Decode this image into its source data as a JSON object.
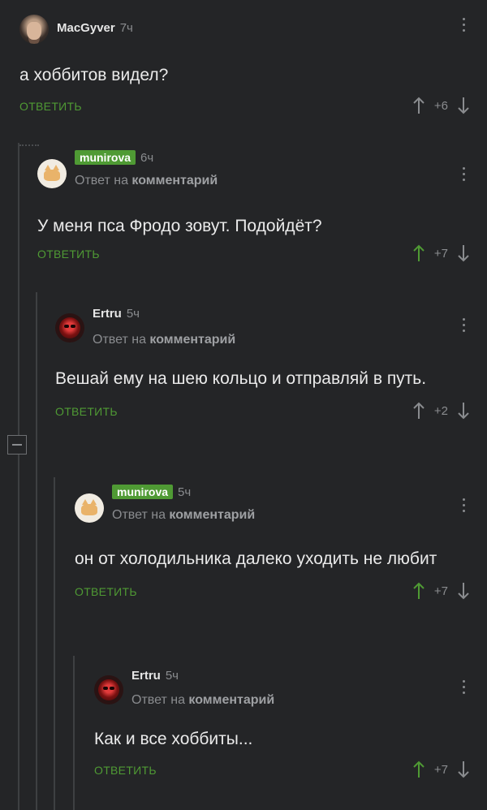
{
  "comments": [
    {
      "username": "MacGyver",
      "time": "7ч",
      "reply_to": "",
      "text": "а хоббитов видел?",
      "reply_label": "ОТВЕТИТЬ",
      "score": "+6",
      "upvoted": false,
      "avatar": "photo-avatar",
      "badge": false
    },
    {
      "username": "munirova",
      "time": "6ч",
      "reply_to_prefix": "Ответ на",
      "reply_to_bold": "комментарий",
      "text": "У меня пса Фродо зовут. Подойдёт?",
      "reply_label": "ОТВЕТИТЬ",
      "score": "+7",
      "upvoted": true,
      "avatar": "cat-avatar",
      "badge": true
    },
    {
      "username": "Ertru",
      "time": "5ч",
      "reply_to_prefix": "Ответ на",
      "reply_to_bold": "комментарий",
      "text": "Вешай ему на шею кольцо и отправляй в путь.",
      "reply_label": "ОТВЕТИТЬ",
      "score": "+2",
      "upvoted": false,
      "avatar": "red-mask-avatar",
      "badge": false
    },
    {
      "username": "munirova",
      "time": "5ч",
      "reply_to_prefix": "Ответ на",
      "reply_to_bold": "комментарий",
      "text": "он от холодильника далеко уходить не любит",
      "reply_label": "ОТВЕТИТЬ",
      "score": "+7",
      "upvoted": true,
      "avatar": "cat-avatar",
      "badge": true
    },
    {
      "username": "Ertru",
      "time": "5ч",
      "reply_to_prefix": "Ответ на",
      "reply_to_bold": "комментарий",
      "text": "Как и все хоббиты...",
      "reply_label": "ОТВЕТИТЬ",
      "score": "+7",
      "upvoted": true,
      "avatar": "red-mask-avatar",
      "badge": false
    }
  ],
  "colors": {
    "background": "#242527",
    "accent_green": "#4f9a34",
    "muted": "#8a8c8f"
  }
}
